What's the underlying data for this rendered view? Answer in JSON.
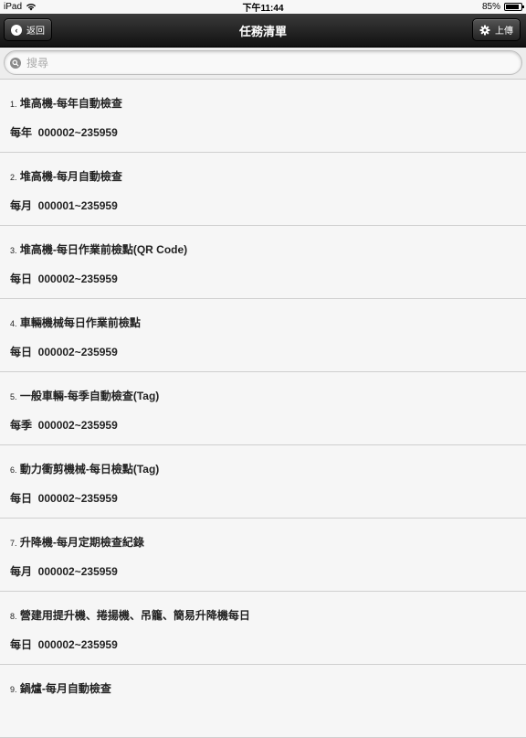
{
  "status": {
    "device": "iPad",
    "time": "下午11:44",
    "battery": "85%"
  },
  "nav": {
    "title": "任務清單",
    "back_label": "返回",
    "upload_label": "上傳"
  },
  "search": {
    "placeholder": "搜尋"
  },
  "tasks": [
    {
      "num": "1.",
      "title": "堆高機-每年自動檢查",
      "sub": "每年  000002~235959"
    },
    {
      "num": "2.",
      "title": "堆高機-每月自動檢查",
      "sub": "每月  000001~235959"
    },
    {
      "num": "3.",
      "title": "堆高機-每日作業前檢點(QR Code)",
      "sub": "每日  000002~235959"
    },
    {
      "num": "4.",
      "title": "車輛機械每日作業前檢點",
      "sub": "每日  000002~235959"
    },
    {
      "num": "5.",
      "title": "一般車輛-每季自動檢查(Tag)",
      "sub": "每季  000002~235959"
    },
    {
      "num": "6.",
      "title": "動力衝剪機械-每日檢點(Tag)",
      "sub": "每日  000002~235959"
    },
    {
      "num": "7.",
      "title": "升降機-每月定期檢查紀錄",
      "sub": "每月  000002~235959"
    },
    {
      "num": "8.",
      "title": "營建用提升機、捲揚機、吊籠、簡易升降機每日",
      "sub": "每日  000002~235959"
    },
    {
      "num": "9.",
      "title": "鍋爐-每月自動檢查",
      "sub": ""
    }
  ]
}
